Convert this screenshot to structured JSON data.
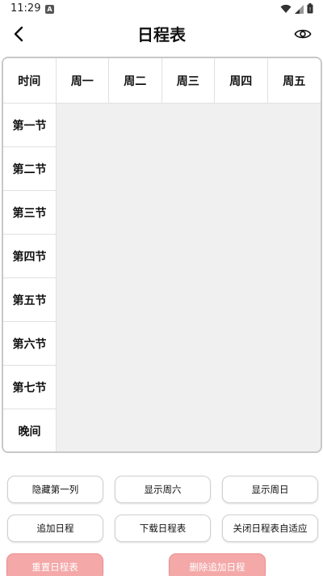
{
  "status_bar": {
    "time": "11:29",
    "notification_letter": "A"
  },
  "app_bar": {
    "title": "日程表"
  },
  "schedule": {
    "corner_label": "时间",
    "days": [
      "周一",
      "周二",
      "周三",
      "周四",
      "周五"
    ],
    "periods": [
      "第一节",
      "第二节",
      "第三节",
      "第四节",
      "第五节",
      "第六节",
      "第七节",
      "晚间"
    ]
  },
  "buttons": {
    "hide_first_column": "隐藏第一列",
    "show_saturday": "显示周六",
    "show_sunday": "显示周日",
    "add_schedule": "追加日程",
    "download_schedule": "下载日程表",
    "close_auto_fit": "关闭日程表自适应",
    "reset_schedule": "重置日程表",
    "delete_added_schedule": "删除追加日程"
  },
  "colors": {
    "accent_red": "#f4a8a8",
    "grid_bg": "#f0f0f0",
    "border": "#c8c8c8"
  }
}
